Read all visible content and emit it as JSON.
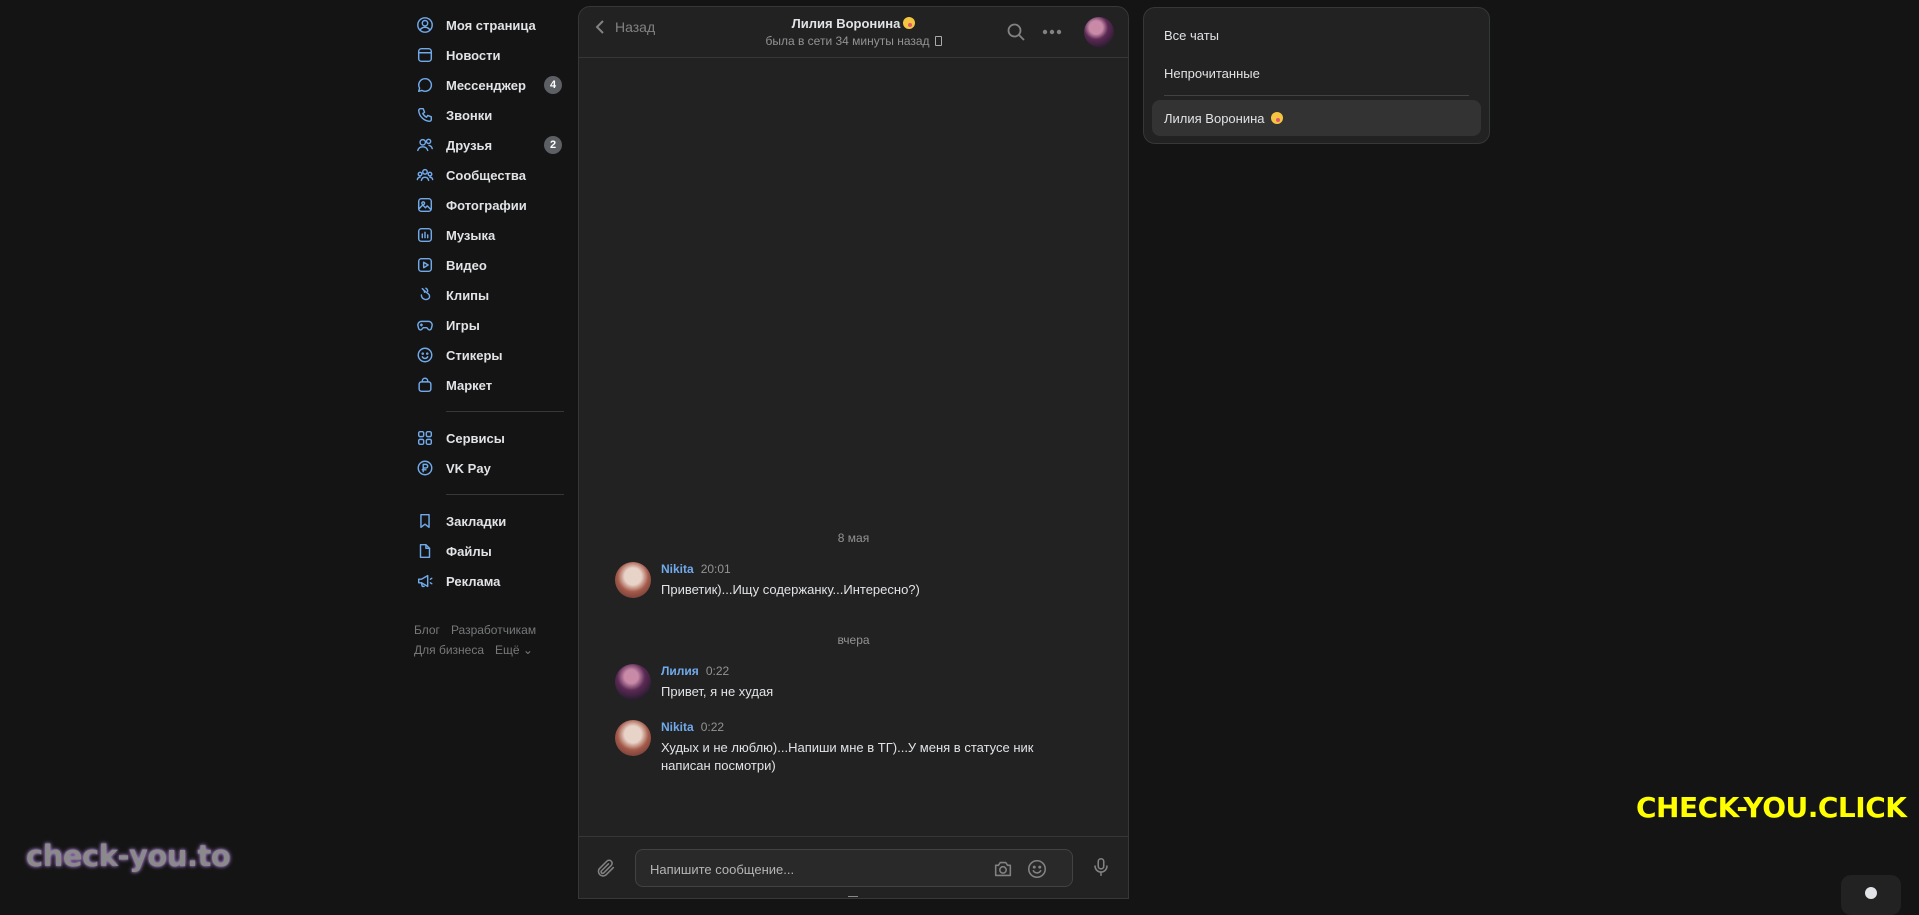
{
  "sidebar": {
    "items": [
      {
        "label": "Моя страница",
        "icon": "user-circle-icon"
      },
      {
        "label": "Новости",
        "icon": "news-icon"
      },
      {
        "label": "Мессенджер",
        "icon": "message-icon",
        "badge": "4"
      },
      {
        "label": "Звонки",
        "icon": "phone-icon"
      },
      {
        "label": "Друзья",
        "icon": "friends-icon",
        "badge": "2"
      },
      {
        "label": "Сообщества",
        "icon": "communities-icon"
      },
      {
        "label": "Фотографии",
        "icon": "photo-icon"
      },
      {
        "label": "Музыка",
        "icon": "music-icon"
      },
      {
        "label": "Видео",
        "icon": "video-icon"
      },
      {
        "label": "Клипы",
        "icon": "clips-icon"
      },
      {
        "label": "Игры",
        "icon": "gamepad-icon"
      },
      {
        "label": "Стикеры",
        "icon": "sticker-icon"
      },
      {
        "label": "Маркет",
        "icon": "market-bag-icon"
      }
    ],
    "items2": [
      {
        "label": "Сервисы",
        "icon": "services-grid-icon"
      },
      {
        "label": "VK Pay",
        "icon": "vkpay-icon"
      }
    ],
    "items3": [
      {
        "label": "Закладки",
        "icon": "bookmark-icon"
      },
      {
        "label": "Файлы",
        "icon": "file-icon"
      },
      {
        "label": "Реклама",
        "icon": "megaphone-icon"
      }
    ],
    "footer": {
      "blog": "Блог",
      "developers": "Разработчикам",
      "business": "Для бизнеса",
      "more": "Ещё"
    }
  },
  "chat": {
    "back_label": "Назад",
    "peer_name": "Лилия Воронина",
    "peer_status": "была в сети 34 минуты назад",
    "date1": "8 мая",
    "date2": "вчера",
    "messages": [
      {
        "author": "Nikita",
        "time": "20:01",
        "text": "Приветик)...Ищу содержанку...Интересно?)"
      },
      {
        "author": "Лилия",
        "time": "0:22",
        "text": "Привет, я не худая"
      },
      {
        "author": "Nikita",
        "time": "0:22",
        "text": "Худых и не люблю)...Напиши мне в ТГ)...У меня в статусе ник написан посмотри)"
      }
    ],
    "composer_placeholder": "Напишите сообщение..."
  },
  "right_panel": {
    "all_chats": "Все чаты",
    "unread": "Непрочитанные",
    "active_chat": "Лилия Воронина"
  },
  "watermarks": {
    "left": "check-you.to",
    "right": "CHECK-YOU.CLICK"
  },
  "colors": {
    "accent": "#71aaeb",
    "background": "#141414",
    "panel": "#222222",
    "watermark_yellow": "#ffff00"
  }
}
